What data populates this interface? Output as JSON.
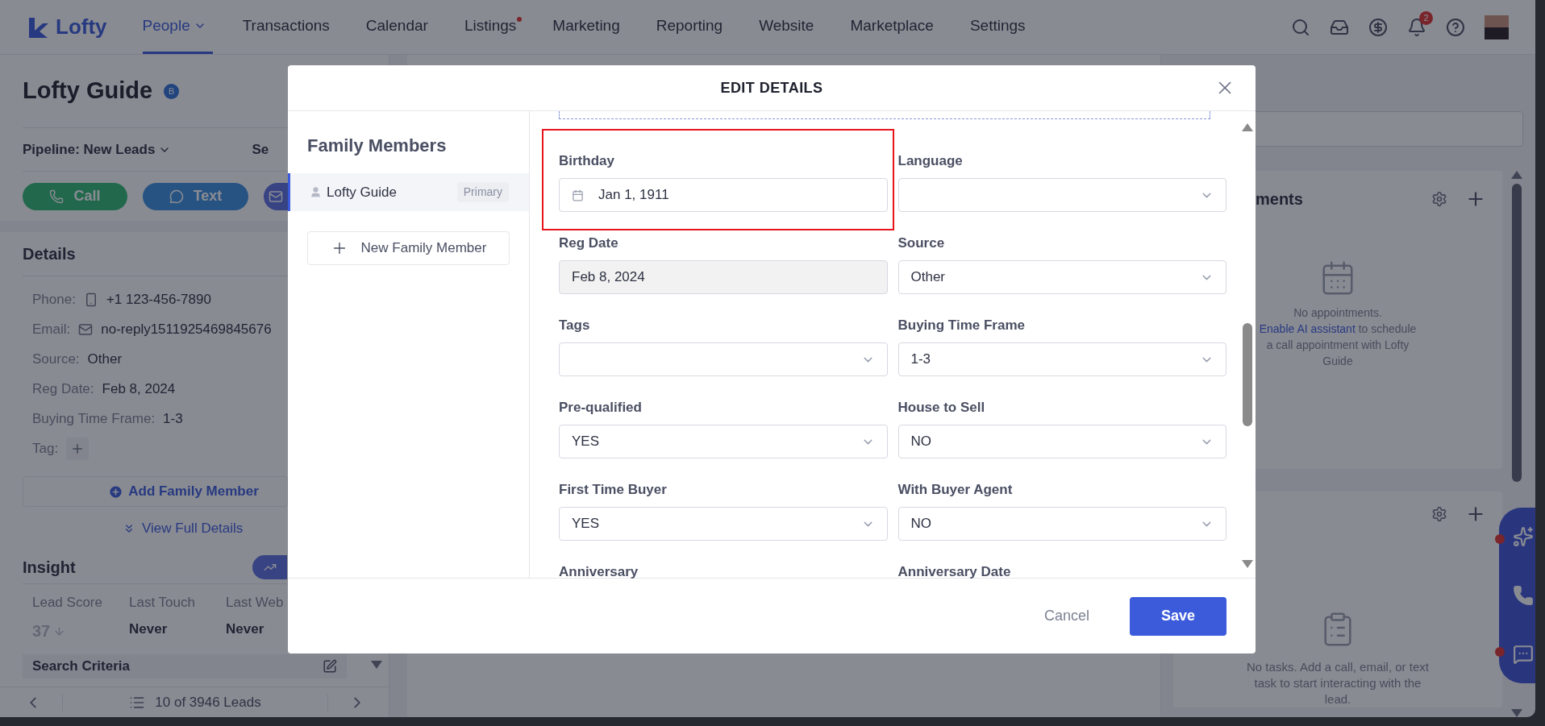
{
  "nav": {
    "logo": "Lofty",
    "items": [
      {
        "label": "People",
        "selected": true,
        "dropdown": true,
        "dot": false
      },
      {
        "label": "Transactions",
        "selected": false,
        "dropdown": false,
        "dot": false
      },
      {
        "label": "Calendar",
        "selected": false,
        "dropdown": false,
        "dot": false
      },
      {
        "label": "Listings",
        "selected": false,
        "dropdown": false,
        "dot": true
      },
      {
        "label": "Marketing",
        "selected": false,
        "dropdown": false,
        "dot": false
      },
      {
        "label": "Reporting",
        "selected": false,
        "dropdown": false,
        "dot": false
      },
      {
        "label": "Website",
        "selected": false,
        "dropdown": false,
        "dot": false
      },
      {
        "label": "Marketplace",
        "selected": false,
        "dropdown": false,
        "dot": false
      },
      {
        "label": "Settings",
        "selected": false,
        "dropdown": false,
        "dot": false
      }
    ],
    "notification_count": "2"
  },
  "lead": {
    "name": "Lofty Guide",
    "badge": "B",
    "pipeline": "Pipeline: New Leads",
    "segment": "Se",
    "actions": [
      {
        "kind": "call",
        "label": "Call"
      },
      {
        "kind": "text",
        "label": "Text"
      },
      {
        "kind": "email"
      }
    ]
  },
  "details": {
    "title": "Details",
    "rows": [
      {
        "kind": "phone",
        "label": "Phone:",
        "value": "+1 123-456-7890"
      },
      {
        "kind": "email",
        "label": "Email:",
        "value": "no-reply1511925469845676"
      },
      {
        "kind": "plain",
        "label": "Source:",
        "value": "Other"
      },
      {
        "kind": "plain",
        "label": "Reg Date:",
        "value": "Feb 8, 2024"
      },
      {
        "kind": "plain",
        "label": "Buying Time Frame:",
        "value": "1-3"
      },
      {
        "kind": "tag",
        "label": "Tag:"
      }
    ],
    "add_family": "Add Family Member",
    "view_full": "View Full Details"
  },
  "insight": {
    "title": "Insight",
    "stats": [
      {
        "kind": "score",
        "label": "Lead Score",
        "value": "37"
      },
      {
        "kind": "plain",
        "label": "Last Touch",
        "value": "Never"
      },
      {
        "kind": "plain",
        "label": "Last Web",
        "value": "Never"
      }
    ]
  },
  "search_criteria": "Search Criteria",
  "pager": "10 of 3946 Leads",
  "appointments": {
    "title": "ments",
    "text": "No appointments.",
    "link": "Enable AI assistant",
    "rest": "to schedule a call appointment with Lofty Guide"
  },
  "tasks": {
    "text": "No tasks. Add a call, email, or text task to start interacting with the lead."
  },
  "modal": {
    "title": "EDIT DETAILS",
    "sidebar_title": "Family Members",
    "members": [
      {
        "name": "Lofty Guide",
        "tag": "Primary",
        "selected": true
      }
    ],
    "new_member": "New Family Member",
    "fields": [
      {
        "label": "Birthday",
        "kind": "date",
        "value": "Jan 1, 1911",
        "highlighted": true
      },
      {
        "label": "Language",
        "kind": "select",
        "highlighted": false
      },
      {
        "label": "Reg Date",
        "kind": "readonly",
        "value": "Feb 8, 2024",
        "highlighted": false
      },
      {
        "label": "Source",
        "kind": "select",
        "value": "Other",
        "highlighted": false
      },
      {
        "label": "Tags",
        "kind": "select",
        "highlighted": false
      },
      {
        "label": "Buying Time Frame",
        "kind": "select",
        "value": "1-3",
        "highlighted": false
      },
      {
        "label": "Pre-qualified",
        "kind": "select",
        "value": "YES",
        "highlighted": false
      },
      {
        "label": "House to Sell",
        "kind": "select",
        "value": "NO",
        "highlighted": false
      },
      {
        "label": "First Time Buyer",
        "kind": "select",
        "value": "YES",
        "highlighted": false
      },
      {
        "label": "With Buyer Agent",
        "kind": "select",
        "value": "NO",
        "highlighted": false
      },
      {
        "label": "Anniversary",
        "kind": "label",
        "highlighted": false
      },
      {
        "label": "Anniversary Date",
        "kind": "label",
        "highlighted": false
      }
    ],
    "cancel": "Cancel",
    "save": "Save"
  }
}
